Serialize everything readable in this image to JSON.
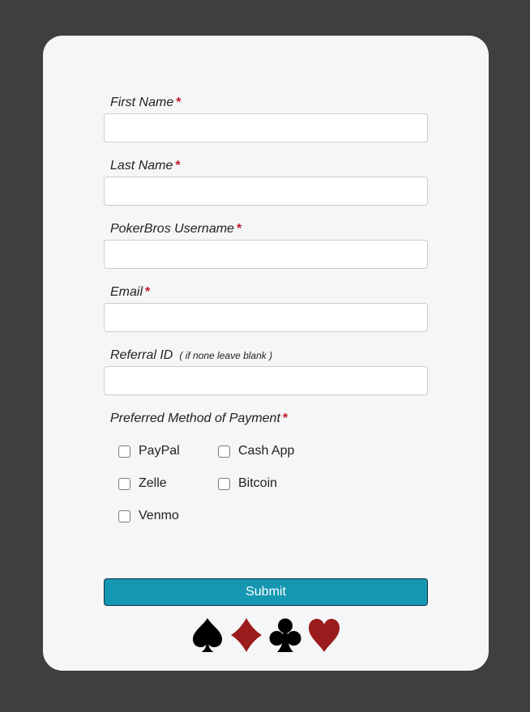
{
  "form": {
    "fields": [
      {
        "label": "First Name",
        "required": "*",
        "value": ""
      },
      {
        "label": "Last Name",
        "required": "*",
        "value": ""
      },
      {
        "label": "PokerBros Username",
        "required": "*",
        "value": ""
      },
      {
        "label": "Email",
        "required": "*",
        "value": ""
      },
      {
        "label": "Referral ID",
        "hint": "( if none leave blank )",
        "value": ""
      }
    ],
    "payment": {
      "label": "Preferred Method of Payment",
      "required": "*",
      "options": [
        "PayPal",
        "Cash App",
        "Zelle",
        "Bitcoin",
        "Venmo"
      ]
    },
    "submit_label": "Submit"
  },
  "suits": [
    {
      "icon": "spade-icon",
      "color": "#000000"
    },
    {
      "icon": "diamond-icon",
      "color": "#9b1c1c"
    },
    {
      "icon": "club-icon",
      "color": "#000000"
    },
    {
      "icon": "heart-icon",
      "color": "#9b1c1c"
    }
  ],
  "colors": {
    "background": "#3f3f3f",
    "card": "#f5f6f8",
    "required": "#c0192b",
    "submit": "#1597b1"
  }
}
